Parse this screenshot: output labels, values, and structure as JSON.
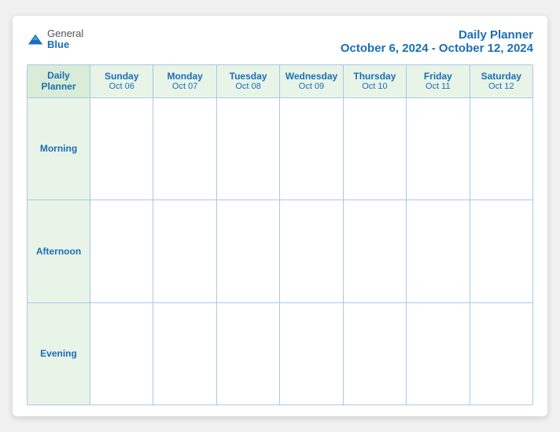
{
  "header": {
    "logo": {
      "general": "General",
      "blue": "Blue",
      "icon": "▶"
    },
    "title": "Daily Planner",
    "date_range": "October 6, 2024 - October 12, 2024"
  },
  "grid": {
    "label_col": {
      "top_label_line1": "Daily",
      "top_label_line2": "Planner"
    },
    "days": [
      {
        "day": "Sunday",
        "date": "Oct 06"
      },
      {
        "day": "Monday",
        "date": "Oct 07"
      },
      {
        "day": "Tuesday",
        "date": "Oct 08"
      },
      {
        "day": "Wednesday",
        "date": "Oct 09"
      },
      {
        "day": "Thursday",
        "date": "Oct 10"
      },
      {
        "day": "Friday",
        "date": "Oct 11"
      },
      {
        "day": "Saturday",
        "date": "Oct 12"
      }
    ],
    "rows": [
      {
        "label": "Morning"
      },
      {
        "label": "Afternoon"
      },
      {
        "label": "Evening"
      }
    ]
  },
  "colors": {
    "accent": "#1a6eb5",
    "header_bg": "#e8f4e8",
    "border": "#a8c8e8"
  }
}
